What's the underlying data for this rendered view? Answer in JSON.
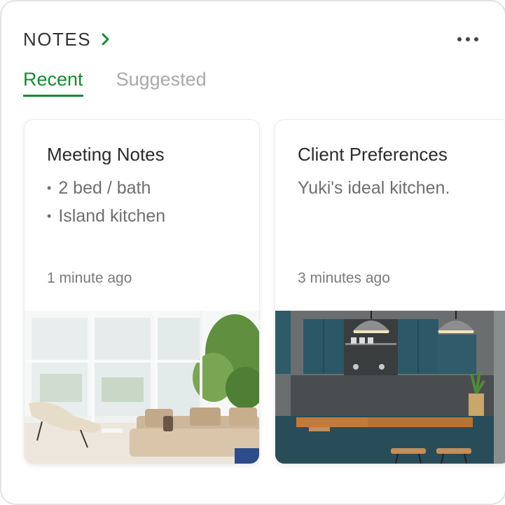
{
  "header": {
    "title": "NOTES",
    "chevron_icon": "chevron-right-icon",
    "more_icon": "more-horizontal-icon"
  },
  "tabs": [
    {
      "label": "Recent",
      "active": true
    },
    {
      "label": "Suggested",
      "active": false
    }
  ],
  "notes": [
    {
      "title": "Meeting Notes",
      "bullets": [
        "2 bed / bath",
        "Island kitchen"
      ],
      "time": "1 minute ago",
      "image": "bright-living-room-photo"
    },
    {
      "title": "Client Preferences",
      "text": "Yuki's ideal kitchen.",
      "time": "3 minutes ago",
      "image": "teal-kitchen-photo"
    }
  ],
  "colors": {
    "accent": "#158c33",
    "title_text": "#333333",
    "muted_text": "#6f6f6f",
    "tab_inactive": "#a9a9a9"
  }
}
